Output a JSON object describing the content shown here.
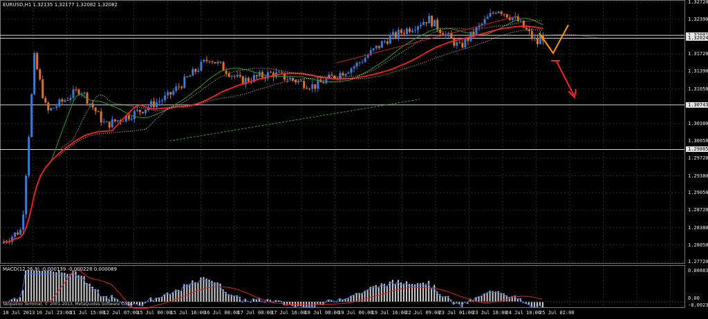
{
  "symbol_header": "EURUSD,H1  1.32135 1.32177 1.32082 1.32082",
  "macd_header": "MACD(12,26,9) -0.000139 -0.000228 0.000089",
  "copyright": "Skopalino Terminal, © 2001-2013, MetaQuotes Software Corp.",
  "price_axis": [
    {
      "label": "1.32720",
      "value": 1.3272
    },
    {
      "label": "1.32390",
      "value": 1.3239
    },
    {
      "label": "1.32081",
      "value": 1.32081,
      "style": "box"
    },
    {
      "label": "1.32024",
      "value": 1.32024,
      "style": "box"
    },
    {
      "label": "1.31720",
      "value": 1.3172
    },
    {
      "label": "1.31390",
      "value": 1.3139
    },
    {
      "label": "1.31050",
      "value": 1.3105
    },
    {
      "label": "1.30743",
      "value": 1.30743,
      "style": "box"
    },
    {
      "label": "1.30380",
      "value": 1.3038
    },
    {
      "label": "1.30050",
      "value": 1.3005
    },
    {
      "label": "1.29885",
      "value": 1.29885,
      "style": "box"
    },
    {
      "label": "1.29720",
      "value": 1.2972
    },
    {
      "label": "1.29380",
      "value": 1.2938
    },
    {
      "label": "1.29050",
      "value": 1.2905
    },
    {
      "label": "1.28720",
      "value": 1.2872
    },
    {
      "label": "1.28380",
      "value": 1.2838
    },
    {
      "label": "1.28050",
      "value": 1.2805
    },
    {
      "label": "1.27720",
      "value": 1.2772
    }
  ],
  "macd_axis": [
    {
      "label": "0.008832"
    },
    {
      "label": "0.00"
    },
    {
      "label": "-0.002383"
    }
  ],
  "time_axis": [
    "10 Jul 2013",
    "10 Jul 23:00",
    "11 Jul 15:00",
    "12 Jul 07:00",
    "15 Jul 00:00",
    "15 Jul 16:00",
    "16 Jul 08:00",
    "17 Jul 00:00",
    "17 Jul 16:00",
    "18 Jul 08:00",
    "19 Jul 00:00",
    "19 Jul 16:00",
    "22 Jul 09:00",
    "23 Jul 01:00",
    "23 Jul 18:00",
    "24 Jul 10:00",
    "25 Jul 02:00"
  ],
  "horizontal_levels": [
    1.32081,
    1.32024,
    1.30743,
    1.29885
  ],
  "colors": {
    "bull": "#3a7bd5",
    "bear": "#e0702a",
    "grid": "#2d2d2d",
    "ma_fast": "#2aa02a",
    "ma_slow": "#ff2020",
    "cloud": "#f0c090",
    "arrow": "#ff2222",
    "zigzag": "#ff9900",
    "hline": "#d8d8d8"
  },
  "icons": [
    "arrow-down-right-icon",
    "zigzag-projection-icon"
  ]
}
